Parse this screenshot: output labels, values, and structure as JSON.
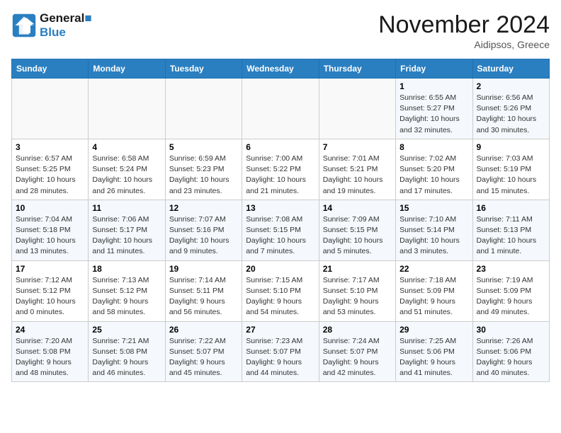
{
  "header": {
    "logo_line1": "General",
    "logo_line2": "Blue",
    "month": "November 2024",
    "location": "Aidipsos, Greece"
  },
  "weekdays": [
    "Sunday",
    "Monday",
    "Tuesday",
    "Wednesday",
    "Thursday",
    "Friday",
    "Saturday"
  ],
  "weeks": [
    [
      {
        "day": "",
        "detail": ""
      },
      {
        "day": "",
        "detail": ""
      },
      {
        "day": "",
        "detail": ""
      },
      {
        "day": "",
        "detail": ""
      },
      {
        "day": "",
        "detail": ""
      },
      {
        "day": "1",
        "detail": "Sunrise: 6:55 AM\nSunset: 5:27 PM\nDaylight: 10 hours\nand 32 minutes."
      },
      {
        "day": "2",
        "detail": "Sunrise: 6:56 AM\nSunset: 5:26 PM\nDaylight: 10 hours\nand 30 minutes."
      }
    ],
    [
      {
        "day": "3",
        "detail": "Sunrise: 6:57 AM\nSunset: 5:25 PM\nDaylight: 10 hours\nand 28 minutes."
      },
      {
        "day": "4",
        "detail": "Sunrise: 6:58 AM\nSunset: 5:24 PM\nDaylight: 10 hours\nand 26 minutes."
      },
      {
        "day": "5",
        "detail": "Sunrise: 6:59 AM\nSunset: 5:23 PM\nDaylight: 10 hours\nand 23 minutes."
      },
      {
        "day": "6",
        "detail": "Sunrise: 7:00 AM\nSunset: 5:22 PM\nDaylight: 10 hours\nand 21 minutes."
      },
      {
        "day": "7",
        "detail": "Sunrise: 7:01 AM\nSunset: 5:21 PM\nDaylight: 10 hours\nand 19 minutes."
      },
      {
        "day": "8",
        "detail": "Sunrise: 7:02 AM\nSunset: 5:20 PM\nDaylight: 10 hours\nand 17 minutes."
      },
      {
        "day": "9",
        "detail": "Sunrise: 7:03 AM\nSunset: 5:19 PM\nDaylight: 10 hours\nand 15 minutes."
      }
    ],
    [
      {
        "day": "10",
        "detail": "Sunrise: 7:04 AM\nSunset: 5:18 PM\nDaylight: 10 hours\nand 13 minutes."
      },
      {
        "day": "11",
        "detail": "Sunrise: 7:06 AM\nSunset: 5:17 PM\nDaylight: 10 hours\nand 11 minutes."
      },
      {
        "day": "12",
        "detail": "Sunrise: 7:07 AM\nSunset: 5:16 PM\nDaylight: 10 hours\nand 9 minutes."
      },
      {
        "day": "13",
        "detail": "Sunrise: 7:08 AM\nSunset: 5:15 PM\nDaylight: 10 hours\nand 7 minutes."
      },
      {
        "day": "14",
        "detail": "Sunrise: 7:09 AM\nSunset: 5:15 PM\nDaylight: 10 hours\nand 5 minutes."
      },
      {
        "day": "15",
        "detail": "Sunrise: 7:10 AM\nSunset: 5:14 PM\nDaylight: 10 hours\nand 3 minutes."
      },
      {
        "day": "16",
        "detail": "Sunrise: 7:11 AM\nSunset: 5:13 PM\nDaylight: 10 hours\nand 1 minute."
      }
    ],
    [
      {
        "day": "17",
        "detail": "Sunrise: 7:12 AM\nSunset: 5:12 PM\nDaylight: 10 hours\nand 0 minutes."
      },
      {
        "day": "18",
        "detail": "Sunrise: 7:13 AM\nSunset: 5:12 PM\nDaylight: 9 hours\nand 58 minutes."
      },
      {
        "day": "19",
        "detail": "Sunrise: 7:14 AM\nSunset: 5:11 PM\nDaylight: 9 hours\nand 56 minutes."
      },
      {
        "day": "20",
        "detail": "Sunrise: 7:15 AM\nSunset: 5:10 PM\nDaylight: 9 hours\nand 54 minutes."
      },
      {
        "day": "21",
        "detail": "Sunrise: 7:17 AM\nSunset: 5:10 PM\nDaylight: 9 hours\nand 53 minutes."
      },
      {
        "day": "22",
        "detail": "Sunrise: 7:18 AM\nSunset: 5:09 PM\nDaylight: 9 hours\nand 51 minutes."
      },
      {
        "day": "23",
        "detail": "Sunrise: 7:19 AM\nSunset: 5:09 PM\nDaylight: 9 hours\nand 49 minutes."
      }
    ],
    [
      {
        "day": "24",
        "detail": "Sunrise: 7:20 AM\nSunset: 5:08 PM\nDaylight: 9 hours\nand 48 minutes."
      },
      {
        "day": "25",
        "detail": "Sunrise: 7:21 AM\nSunset: 5:08 PM\nDaylight: 9 hours\nand 46 minutes."
      },
      {
        "day": "26",
        "detail": "Sunrise: 7:22 AM\nSunset: 5:07 PM\nDaylight: 9 hours\nand 45 minutes."
      },
      {
        "day": "27",
        "detail": "Sunrise: 7:23 AM\nSunset: 5:07 PM\nDaylight: 9 hours\nand 44 minutes."
      },
      {
        "day": "28",
        "detail": "Sunrise: 7:24 AM\nSunset: 5:07 PM\nDaylight: 9 hours\nand 42 minutes."
      },
      {
        "day": "29",
        "detail": "Sunrise: 7:25 AM\nSunset: 5:06 PM\nDaylight: 9 hours\nand 41 minutes."
      },
      {
        "day": "30",
        "detail": "Sunrise: 7:26 AM\nSunset: 5:06 PM\nDaylight: 9 hours\nand 40 minutes."
      }
    ]
  ]
}
